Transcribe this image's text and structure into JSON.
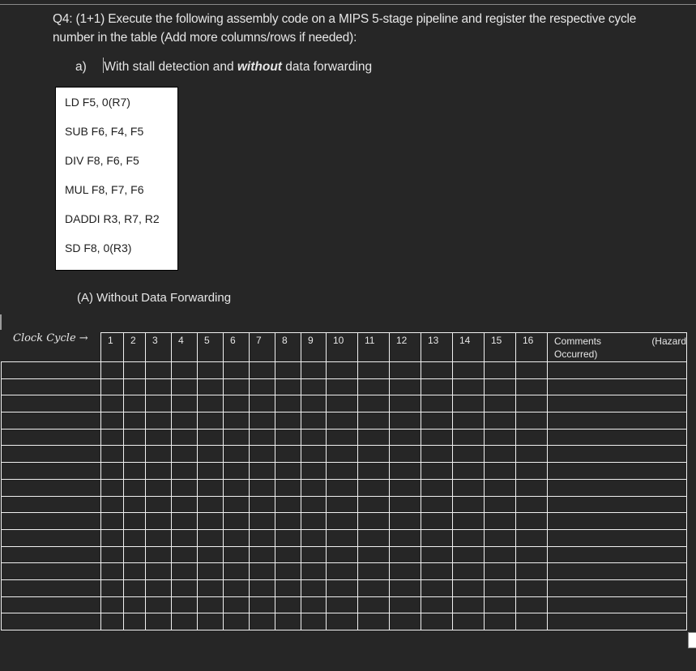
{
  "question": {
    "text": "Q4: (1+1) Execute the following assembly code on a MIPS 5-stage pipeline and register the respective cycle number in the table (Add more columns/rows if needed):"
  },
  "subquestion": {
    "label": "a)",
    "text_before": "With stall detection and ",
    "emphasis": "without",
    "text_after": " data forwarding"
  },
  "code": [
    "LD F5, 0(R7)",
    "SUB F6, F4, F5",
    "DIV F8, F6, F5",
    "MUL F8, F7, F6",
    "DADDI R3, R7, R2",
    "SD F8, 0(R3)"
  ],
  "section_title": "(A)  Without Data Forwarding",
  "table": {
    "row_label_header": "Clock Cycle →",
    "cycles": [
      "1",
      "2",
      "3",
      "4",
      "5",
      "6",
      "7",
      "8",
      "9",
      "10",
      "11",
      "12",
      "13",
      "14",
      "15",
      "16"
    ],
    "comments_header_left": "Comments",
    "comments_header_right": "(Hazard",
    "comments_header_line2": "Occurred)",
    "body_row_count": 16
  }
}
